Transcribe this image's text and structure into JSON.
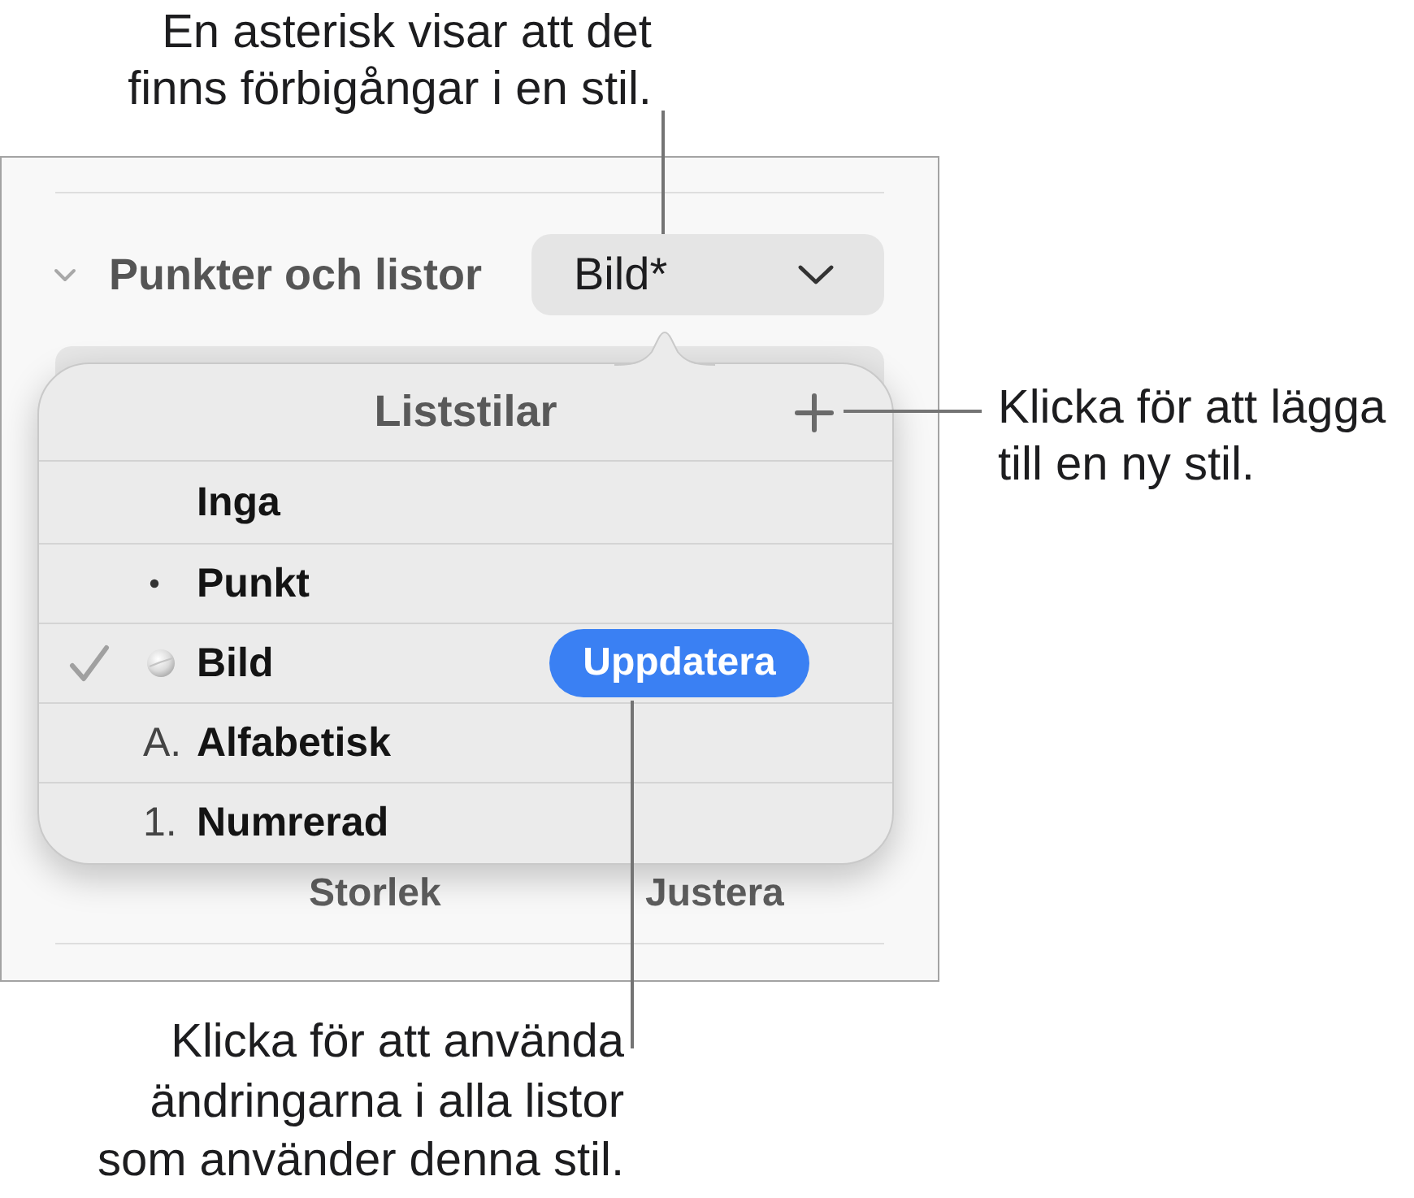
{
  "top_callout": {
    "text": "En asterisk visar att det\nfinns förbigångar i en stil."
  },
  "panel": {
    "section": {
      "title": "Punkter och listor",
      "expanded": true
    },
    "style_popup": {
      "value": "Bild*"
    },
    "popover": {
      "title": "Liststilar",
      "rows": [
        {
          "kind": "none",
          "label": "Inga",
          "selected": false
        },
        {
          "kind": "bullet",
          "label": "Punkt",
          "selected": false
        },
        {
          "kind": "image",
          "label": "Bild",
          "selected": true,
          "button": "Uppdatera"
        },
        {
          "kind": "letter",
          "marker": "A.",
          "label": "Alfabetisk",
          "selected": false
        },
        {
          "kind": "number",
          "marker": "1.",
          "label": "Numrerad",
          "selected": false
        }
      ]
    },
    "control_labels": [
      "Storlek",
      "Justera"
    ]
  },
  "right_callout": {
    "text": "Klicka för att lägga\ntill en ny stil."
  },
  "bottom_callout": {
    "text": "Klicka för att använda\nändringarna i alla listor\nsom använder denna stil."
  }
}
